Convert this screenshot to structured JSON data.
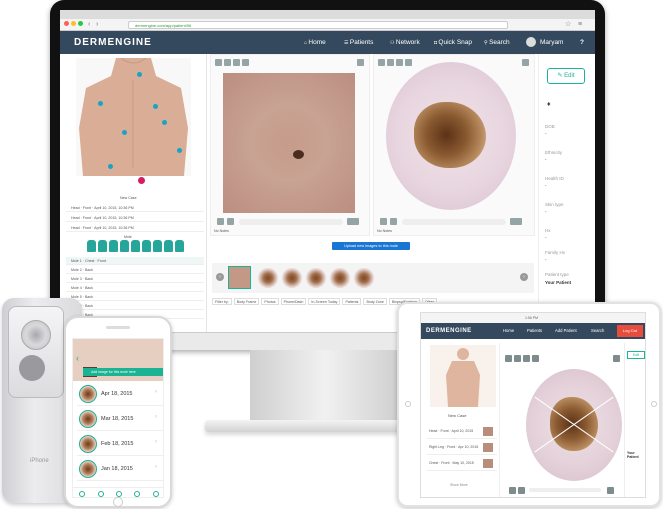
{
  "browser": {
    "url": "dermengine.com/app/patient/96"
  },
  "app": {
    "logo": "DERMENGINE",
    "nav": {
      "home": "Home",
      "patients": "Patients",
      "network": "Network",
      "quick_snap": "Quick Snap",
      "search": "Search",
      "user": "Maryam",
      "help": "?"
    },
    "left_panel": {
      "section_label": "New Case",
      "entries": [
        "Head · Front · April 10, 2015, 10:36 PM",
        "Head · Front · April 10, 2015, 10:36 PM",
        "Head · Front · April 10, 2015, 10:36 PM"
      ],
      "body_label": "Mole",
      "list": [
        "Mole 1 · Chest · Front",
        "Mole 2 · Back",
        "Mole 3 · Back",
        "Mole 4 · Back",
        "Mole 5 · Back",
        "Mole 6 · Back",
        "Mole 7 · Back"
      ]
    },
    "image_panels": {
      "clinical_label": "No Notes",
      "dermoscopy_label": "No Notes",
      "upload_button": "Upload new images to this mole"
    },
    "filters": [
      "Filter by:",
      "Body Frame",
      "Photos",
      "Phone/Dash",
      "In-Screen Today",
      "Patients",
      "Body Zone",
      "Biopsy/Excision",
      "Other"
    ],
    "right_panel": {
      "edit_button": "Edit",
      "fields": [
        {
          "label": "DOB",
          "value": "-"
        },
        {
          "label": "Ethnicity",
          "value": "-"
        },
        {
          "label": "Health ID",
          "value": "-"
        },
        {
          "label": "Skin type",
          "value": "-"
        },
        {
          "label": "Hx",
          "value": "-"
        },
        {
          "label": "Family Hx",
          "value": "-"
        },
        {
          "label": "Patient type",
          "value": "Your Patient"
        }
      ]
    }
  },
  "phone": {
    "banner": "Add image for this mole here",
    "items": [
      {
        "date": "Apr 18, 2015"
      },
      {
        "date": "Mar 18, 2015"
      },
      {
        "date": "Feb 18, 2015"
      },
      {
        "date": "Jan 18, 2015"
      }
    ]
  },
  "iphone_back": {
    "brand": "iPhone"
  },
  "ipad": {
    "time": "1:56 PM",
    "logo": "DERMENGINE",
    "nav": {
      "home": "Home",
      "patients": "Patients",
      "add_patient": "Add Patient",
      "search": "Search",
      "logout": "Log Out"
    },
    "left_title": "New Case",
    "rows": [
      "Head · Front · April 10, 2015",
      "Right Leg · Front · Apr 10, 2015",
      "Chest · Front · May 10, 2015"
    ],
    "more": "Show More",
    "edit": "Edit",
    "patient_type": "Your Patient"
  },
  "colors": {
    "appbar": "#34495e",
    "accent": "#1ab394",
    "danger": "#e74c3c"
  }
}
